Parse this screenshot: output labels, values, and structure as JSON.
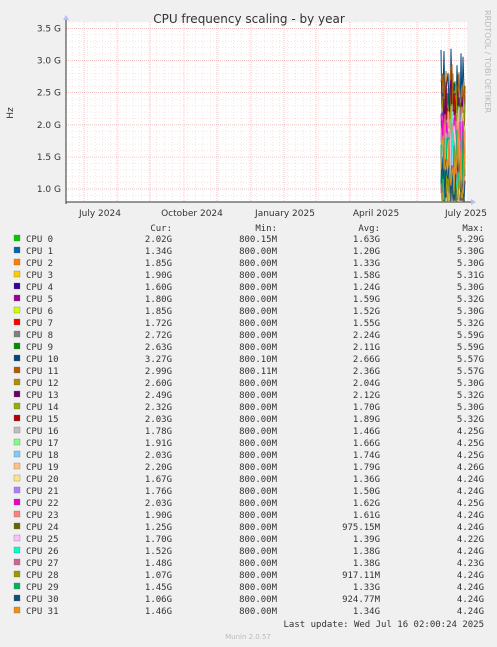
{
  "chart_data": {
    "type": "line",
    "title": "CPU frequency scaling - by year",
    "side_label": "RRDTOOL / TOBI OETIKER",
    "ylabel": "Hz",
    "ylim": [
      0.8,
      3.6
    ],
    "yticks": [
      "1.0 G",
      "1.5 G",
      "2.0 G",
      "2.5 G",
      "3.0 G",
      "3.5 G"
    ],
    "xticks": [
      "July 2024",
      "October 2024",
      "January 2025",
      "April 2025",
      "July 2025"
    ],
    "grid": true,
    "legend_headers": [
      "Cur:",
      "Min:",
      "Avg:",
      "Max:"
    ],
    "series": [
      {
        "name": "CPU 0",
        "color": "#00cc00",
        "cur": "2.02G",
        "min": "800.15M",
        "avg": "1.63G",
        "max": "5.29G"
      },
      {
        "name": "CPU 1",
        "color": "#0066b3",
        "cur": "1.34G",
        "min": "800.00M",
        "avg": "1.20G",
        "max": "5.30G"
      },
      {
        "name": "CPU 2",
        "color": "#ff8000",
        "cur": "1.85G",
        "min": "800.00M",
        "avg": "1.33G",
        "max": "5.30G"
      },
      {
        "name": "CPU 3",
        "color": "#ffcc00",
        "cur": "1.90G",
        "min": "800.00M",
        "avg": "1.58G",
        "max": "5.31G"
      },
      {
        "name": "CPU 4",
        "color": "#330099",
        "cur": "1.60G",
        "min": "800.00M",
        "avg": "1.24G",
        "max": "5.30G"
      },
      {
        "name": "CPU 5",
        "color": "#990099",
        "cur": "1.80G",
        "min": "800.00M",
        "avg": "1.59G",
        "max": "5.32G"
      },
      {
        "name": "CPU 6",
        "color": "#ccff00",
        "cur": "1.85G",
        "min": "800.00M",
        "avg": "1.52G",
        "max": "5.30G"
      },
      {
        "name": "CPU 7",
        "color": "#ff0000",
        "cur": "1.72G",
        "min": "800.00M",
        "avg": "1.55G",
        "max": "5.32G"
      },
      {
        "name": "CPU 8",
        "color": "#808080",
        "cur": "2.72G",
        "min": "800.00M",
        "avg": "2.24G",
        "max": "5.59G"
      },
      {
        "name": "CPU 9",
        "color": "#008f00",
        "cur": "2.63G",
        "min": "800.00M",
        "avg": "2.11G",
        "max": "5.59G"
      },
      {
        "name": "CPU 10",
        "color": "#00487d",
        "cur": "3.27G",
        "min": "800.10M",
        "avg": "2.66G",
        "max": "5.57G"
      },
      {
        "name": "CPU 11",
        "color": "#b35a00",
        "cur": "2.99G",
        "min": "800.11M",
        "avg": "2.36G",
        "max": "5.57G"
      },
      {
        "name": "CPU 12",
        "color": "#b38f00",
        "cur": "2.60G",
        "min": "800.00M",
        "avg": "2.04G",
        "max": "5.30G"
      },
      {
        "name": "CPU 13",
        "color": "#6b006b",
        "cur": "2.49G",
        "min": "800.00M",
        "avg": "2.12G",
        "max": "5.32G"
      },
      {
        "name": "CPU 14",
        "color": "#8fb300",
        "cur": "2.32G",
        "min": "800.00M",
        "avg": "1.70G",
        "max": "5.30G"
      },
      {
        "name": "CPU 15",
        "color": "#b30000",
        "cur": "2.03G",
        "min": "800.00M",
        "avg": "1.89G",
        "max": "5.32G"
      },
      {
        "name": "CPU 16",
        "color": "#bebebe",
        "cur": "1.78G",
        "min": "800.00M",
        "avg": "1.46G",
        "max": "4.25G"
      },
      {
        "name": "CPU 17",
        "color": "#80ff80",
        "cur": "1.91G",
        "min": "800.00M",
        "avg": "1.66G",
        "max": "4.25G"
      },
      {
        "name": "CPU 18",
        "color": "#80c9ff",
        "cur": "2.03G",
        "min": "800.00M",
        "avg": "1.74G",
        "max": "4.25G"
      },
      {
        "name": "CPU 19",
        "color": "#ffc080",
        "cur": "2.20G",
        "min": "800.00M",
        "avg": "1.79G",
        "max": "4.26G"
      },
      {
        "name": "CPU 20",
        "color": "#ffe680",
        "cur": "1.67G",
        "min": "800.00M",
        "avg": "1.36G",
        "max": "4.24G"
      },
      {
        "name": "CPU 21",
        "color": "#aa80ff",
        "cur": "1.76G",
        "min": "800.00M",
        "avg": "1.50G",
        "max": "4.24G"
      },
      {
        "name": "CPU 22",
        "color": "#ee00cc",
        "cur": "2.03G",
        "min": "800.00M",
        "avg": "1.62G",
        "max": "4.25G"
      },
      {
        "name": "CPU 23",
        "color": "#ff8080",
        "cur": "1.90G",
        "min": "800.00M",
        "avg": "1.61G",
        "max": "4.24G"
      },
      {
        "name": "CPU 24",
        "color": "#666600",
        "cur": "1.25G",
        "min": "800.00M",
        "avg": "975.15M",
        "max": "4.24G"
      },
      {
        "name": "CPU 25",
        "color": "#ffbfff",
        "cur": "1.70G",
        "min": "800.00M",
        "avg": "1.39G",
        "max": "4.22G"
      },
      {
        "name": "CPU 26",
        "color": "#00ffcc",
        "cur": "1.52G",
        "min": "800.00M",
        "avg": "1.38G",
        "max": "4.24G"
      },
      {
        "name": "CPU 27",
        "color": "#cc6699",
        "cur": "1.48G",
        "min": "800.00M",
        "avg": "1.38G",
        "max": "4.23G"
      },
      {
        "name": "CPU 28",
        "color": "#999900",
        "cur": "1.07G",
        "min": "800.00M",
        "avg": "917.11M",
        "max": "4.24G"
      },
      {
        "name": "CPU 29",
        "color": "#00b359",
        "cur": "1.45G",
        "min": "800.00M",
        "avg": "1.33G",
        "max": "4.24G"
      },
      {
        "name": "CPU 30",
        "color": "#0e4f7a",
        "cur": "1.06G",
        "min": "800.00M",
        "avg": "924.77M",
        "max": "4.24G"
      },
      {
        "name": "CPU 31",
        "color": "#f28c1a",
        "cur": "1.46G",
        "min": "800.00M",
        "avg": "1.34G",
        "max": "4.24G"
      }
    ],
    "last_update": "Last update: Wed Jul 16 02:00:24 2025",
    "footer": "Munin 2.0.57"
  }
}
